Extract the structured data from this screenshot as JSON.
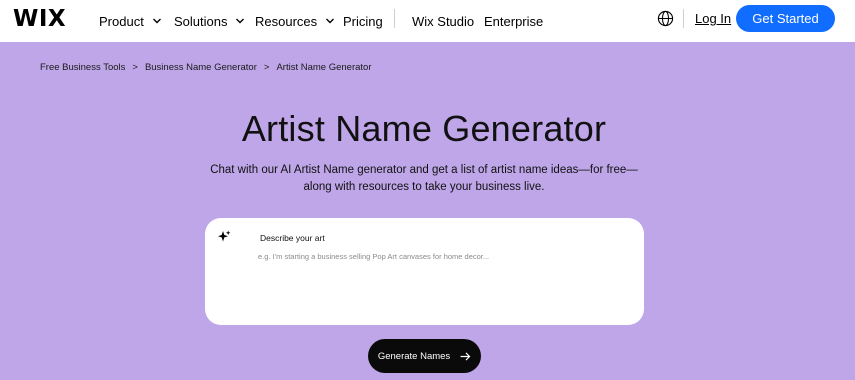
{
  "header": {
    "logo": "WIX",
    "nav": [
      {
        "label": "Product",
        "dropdown": true
      },
      {
        "label": "Solutions",
        "dropdown": true
      },
      {
        "label": "Resources",
        "dropdown": true
      },
      {
        "label": "Pricing",
        "dropdown": false
      }
    ],
    "nav_secondary": [
      {
        "label": "Wix Studio"
      },
      {
        "label": "Enterprise"
      }
    ],
    "language_icon": "globe-icon",
    "login_label": "Log In",
    "cta_label": "Get Started",
    "cta_color": "#116dff"
  },
  "breadcrumb": {
    "items": [
      "Free Business Tools",
      "Business Name Generator",
      "Artist Name Generator"
    ],
    "separator": ">"
  },
  "hero": {
    "title": "Artist Name Generator",
    "subtitle_line1": "Chat with our AI Artist Name generator and get a list of artist name ideas—for free—",
    "subtitle_line2": "along with resources to take your business live.",
    "background_color": "#bea6e8"
  },
  "prompt_card": {
    "icon": "sparkle-icon",
    "label": "Describe your art",
    "value": "",
    "placeholder": "e.g. I'm starting a business selling Pop Art canvases for home decor..."
  },
  "generate_button": {
    "label": "Generate Names",
    "icon": "arrow-right-icon"
  }
}
